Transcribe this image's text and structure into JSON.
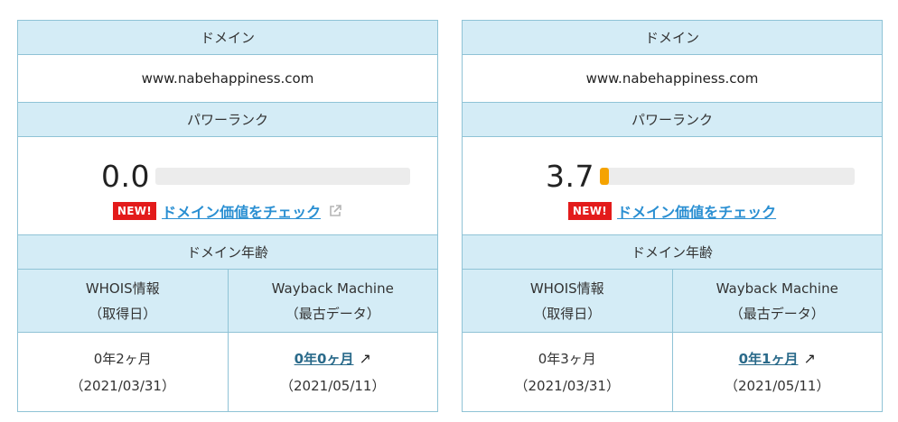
{
  "panels": [
    {
      "domain_header": "ドメイン",
      "domain": "www.nabehappiness.com",
      "rank_header": "パワーランク",
      "rank_value": "0.0",
      "rank_fraction": 0.0,
      "new_badge": "NEW!",
      "check_link": "ドメイン価値をチェック",
      "show_external_icon": true,
      "age_header": "ドメイン年齢",
      "whois_label": "WHOIS情報",
      "whois_sub": "（取得日）",
      "wayback_label": "Wayback Machine",
      "wayback_sub": "（最古データ）",
      "whois_age": "0年2ヶ月",
      "whois_date": "（2021/03/31）",
      "wayback_age": "0年0ヶ月",
      "wayback_date": "（2021/05/11）",
      "arrow": "↗"
    },
    {
      "domain_header": "ドメイン",
      "domain": "www.nabehappiness.com",
      "rank_header": "パワーランク",
      "rank_value": "3.7",
      "rank_fraction": 0.037,
      "new_badge": "NEW!",
      "check_link": "ドメイン価値をチェック",
      "show_external_icon": false,
      "age_header": "ドメイン年齢",
      "whois_label": "WHOIS情報",
      "whois_sub": "（取得日）",
      "wayback_label": "Wayback Machine",
      "wayback_sub": "（最古データ）",
      "whois_age": "0年3ヶ月",
      "whois_date": "（2021/03/31）",
      "wayback_age": "0年1ヶ月",
      "wayback_date": "（2021/05/11）",
      "arrow": "↗"
    }
  ],
  "colors": {
    "header_bg": "#d4ecf6",
    "border": "#8fc3d6",
    "bar_track": "#ececec",
    "bar_fill": "#f5a300",
    "new_badge": "#e31b1b",
    "link": "#2a8fd2"
  }
}
